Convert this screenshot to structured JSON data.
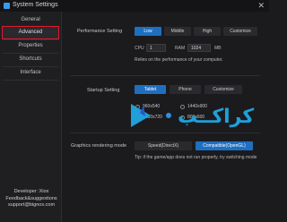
{
  "window": {
    "title": "System Settings",
    "close_glyph": "✕",
    "icon": "app-icon"
  },
  "sidebar": {
    "items": [
      {
        "label": "General"
      },
      {
        "label": "Advanced",
        "active": true
      },
      {
        "label": "Properties"
      },
      {
        "label": "Shortcuts"
      },
      {
        "label": "Interface"
      }
    ],
    "footer": {
      "line1": "Developer :Xiox",
      "line2": "Feedback&suggestions",
      "line3": "support@bignox.com"
    }
  },
  "performance": {
    "label": "Performance Setting",
    "options": [
      "Low",
      "Middle",
      "High",
      "Customize"
    ],
    "selected": "Low",
    "cpu_label": "CPU",
    "cpu_value": "1",
    "ram_label": "RAM",
    "ram_value": "1024",
    "ram_unit": "MB",
    "note": "Relies on the performance of your computer."
  },
  "startup": {
    "label": "Startup Setting",
    "options": [
      "Tablet",
      "Phone",
      "Customize"
    ],
    "selected": "Tablet",
    "resolutions": [
      "960x540",
      "1440x900",
      "1280x720",
      "800x600"
    ],
    "selected_resolution": "1280x720"
  },
  "graphics": {
    "label": "Graphics rendering mode",
    "options": [
      "Speed(DirectX)",
      "Compatible(OpenGL)"
    ],
    "selected": "Compatible(OpenGL)",
    "tip": "Tip: if the game/app does not run properly, try switching mode"
  },
  "watermark": {
    "text": "کراکــب"
  },
  "colors": {
    "accent": "#1f6fc0",
    "highlight": "#e0192c",
    "background": "#1b1b1e"
  }
}
